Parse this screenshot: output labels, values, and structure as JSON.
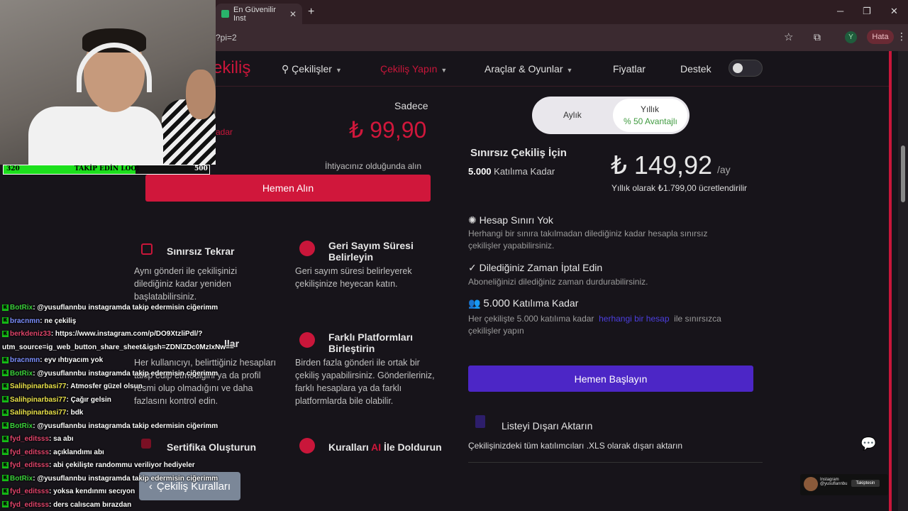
{
  "browser": {
    "tab_title": "En Güvenilir Inst",
    "tab_close": "✕",
    "new_tab": "+",
    "url_fragment": "?pi=2",
    "profile_initial": "Y",
    "error_label": "Hata",
    "win_min": "─",
    "win_max": "❐",
    "win_close": "✕"
  },
  "site": {
    "logo_fragment": "ekiliş",
    "nav": {
      "giveaways": "Çekilişler",
      "make_giveaway": "Çekiliş Yapın",
      "tools_games": "Araçlar & Oyunlar",
      "pricing": "Fiyatlar",
      "support": "Destek"
    }
  },
  "left_plan": {
    "only_label": "Sadece",
    "price": "₺ 99,90",
    "ghost_text": "adar",
    "need_text": "İhtiyacınız olduğunda alın",
    "buy_button": "Hemen Alın"
  },
  "features": [
    {
      "title": "Sınırsız Tekrar",
      "desc": [
        "Aynı gönderi ile çekilişinizi",
        "dilediğiniz kadar yeniden",
        "başlatabilirsiniz."
      ]
    },
    {
      "title_lines": [
        "Geri Sayım Süresi",
        "Belirleyin"
      ],
      "desc": [
        "Geri sayım süresi belirleyerek",
        "çekilişinize heyecan katın."
      ]
    },
    {
      "title": "…llar",
      "desc": [
        "Her kullanıcıyı, belirttiğiniz hesapları",
        "takip edip etmediğini ya da profil",
        "resmi olup olmadığını ve daha",
        "fazlasını kontrol edin."
      ]
    },
    {
      "title_lines": [
        "Farklı Platformları",
        "Birleştirin"
      ],
      "desc": [
        "Birden fazla gönderi ile ortak bir",
        "çekiliş yapabilirsiniz. Gönderileriniz,",
        "farklı hesaplara ya da farklı",
        "platformlarda bile olabilir."
      ]
    },
    {
      "title": "Sertifika Oluşturun"
    },
    {
      "title_pre": "Kuralları ",
      "title_ai": "AI",
      "title_post": " İle Doldurun"
    }
  ],
  "right_plan": {
    "toggle_monthly": "Aylık",
    "toggle_yearly": "Yıllık",
    "advantage": "% 50 Avantajlı",
    "plan_name": "Sınırsız  Çekiliş İçin",
    "plan_count": "5.000",
    "plan_count_suffix": " Katılıma Kadar",
    "price": "₺ 149,92",
    "per": "/ay",
    "yearly_note": "Yıllık olarak ₺1.799,00 ücretlendirilir",
    "benefits": [
      {
        "title": "Hesap Sınırı Yok",
        "desc": [
          "Herhangi bir sınıra takılmadan dilediğiniz kadar hesapla sınırsız",
          "çekilişler yapabilirsiniz."
        ]
      },
      {
        "title": "Dilediğiniz Zaman İptal Edin",
        "desc": [
          "Aboneliğinizi dilediğiniz zaman durdurabilirsiniz."
        ]
      },
      {
        "title_count": "5.000",
        "title": "Katılıma Kadar",
        "desc_pre": "Her çekilişte 5.000 katılıma kadar",
        "desc_link": "herhangi bir hesap",
        "desc_post": "ile sınırsızca",
        "desc_line2": "çekilişler yapın"
      }
    ],
    "start_button": "Hemen Başlayın",
    "export_title": "Listeyi Dışarı Aktarın",
    "export_desc": "Çekilişinizdeki tüm katılımcıları .XLS olarak dışarı aktarın"
  },
  "footer": {
    "rules_button": "Çekiliş Kuralları"
  },
  "overlay": {
    "follow_current": "320",
    "follow_label": "TAKİP EDİN LOO!",
    "follow_max": "500",
    "follow_progress": 0.64,
    "chat": [
      {
        "user": "BotRix",
        "msg": ": @yusuflannbu instagramda takip edermisin ciğerimm",
        "ucls": "u-green"
      },
      {
        "user": "bracnmn",
        "msg": ": ne çekiliş",
        "ucls": "u-blue"
      },
      {
        "user": "berkdeniz33",
        "msg": ": https://www.instagram.com/p/DO9XtzliPdl/?",
        "ucls": "u-red"
      },
      {
        "user": "",
        "msg": "utm_source=ig_web_button_share_sheet&igsh=ZDNlZDc0MzIxNw==",
        "ucls": ""
      },
      {
        "user": "bracnmn",
        "msg": ": eyv ıhtıyacım yok",
        "ucls": "u-blue"
      },
      {
        "user": "BotRix",
        "msg": ": @yusuflannbu instagramda takip edermisin ciğerimm",
        "ucls": "u-green"
      },
      {
        "user": "Salihpinarbasi77",
        "msg": ": Atmosfer güzel olsun",
        "ucls": "u-yellow"
      },
      {
        "user": "Salihpinarbasi77",
        "msg": ": Çağır gelsin",
        "ucls": "u-yellow"
      },
      {
        "user": "Salihpinarbasi77",
        "msg": ": bdk",
        "ucls": "u-yellow"
      },
      {
        "user": "BotRix",
        "msg": ": @yusuflannbu instagramda takip edermisin ciğerimm",
        "ucls": "u-green"
      },
      {
        "user": "fyd_editsss",
        "msg": ": sa abı",
        "ucls": "u-red"
      },
      {
        "user": "fyd_editsss",
        "msg": ": açıklandımı abı",
        "ucls": "u-red"
      },
      {
        "user": "fyd_editsss",
        "msg": ": abi çekilişte randommu veriliyor hediyeler",
        "ucls": "u-red"
      },
      {
        "user": "BotRix",
        "msg": ": @yusuflannbu instagramda takip edermisin ciğerimm",
        "ucls": "u-green"
      },
      {
        "user": "fyd_editsss",
        "msg": ": yoksa kendınmı secıyon",
        "ucls": "u-red"
      },
      {
        "user": "fyd_editsss",
        "msg": ": ders calıscam bırazdan",
        "ucls": "u-red"
      }
    ],
    "ig_name": "Instagram",
    "ig_handle": "@yusuflannbu",
    "ig_follow": "Takiptesin"
  }
}
